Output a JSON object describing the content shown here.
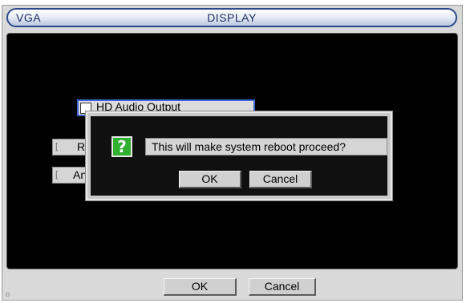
{
  "window": {
    "title_left": "VGA",
    "title": "DISPLAY"
  },
  "settings": {
    "hd_audio_output_label": "HD Audio Output",
    "row2_partial_label": "Re",
    "row3_partial_label": "An"
  },
  "dialog": {
    "icon_glyph": "?",
    "message": "This will make system reboot proceed?",
    "ok_label": "OK",
    "cancel_label": "Cancel"
  },
  "footer": {
    "ok_label": "OK",
    "cancel_label": "Cancel"
  },
  "colors": {
    "title_text": "#1f2f63",
    "title_border": "#2c4a8c",
    "focus_border": "#3a66d6",
    "question_icon": "#2fb02f"
  }
}
